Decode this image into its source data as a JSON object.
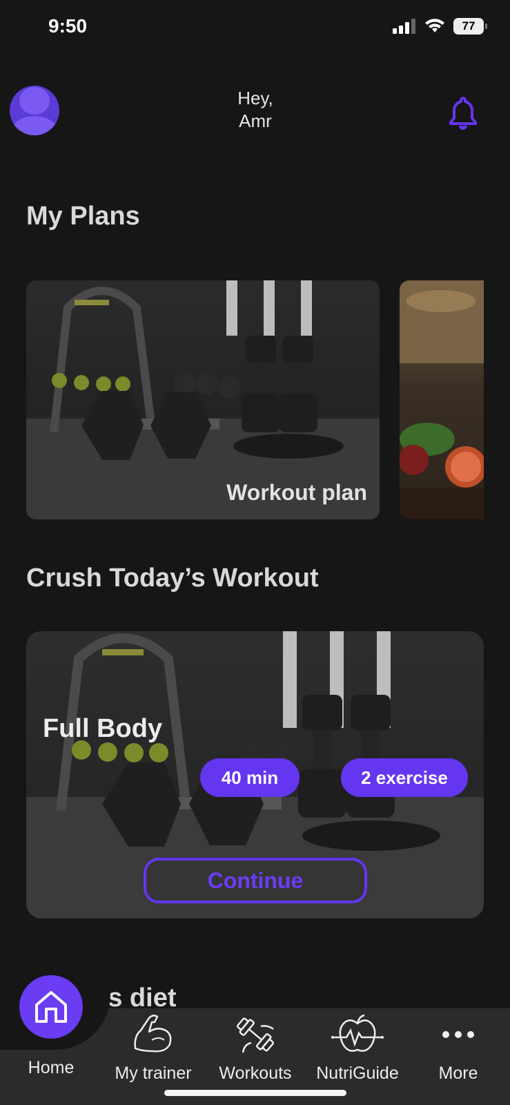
{
  "status_bar": {
    "time": "9:50",
    "battery": "77"
  },
  "header": {
    "greeting_line1": "Hey,",
    "greeting_line2": "Amr"
  },
  "my_plans": {
    "title": "My Plans",
    "cards": [
      {
        "label": "Workout plan"
      }
    ]
  },
  "today_workout": {
    "title": "Crush Today’s Workout",
    "name": "Full Body",
    "duration": "40 min",
    "exercises": "2 exercise",
    "continue_label": "Continue"
  },
  "diet": {
    "title": "Today’s diet"
  },
  "nav": {
    "items": [
      {
        "label": "Home",
        "icon": "home-icon",
        "active": true
      },
      {
        "label": "My trainer",
        "icon": "flexed-arm-icon"
      },
      {
        "label": "Workouts",
        "icon": "dumbbell-icon"
      },
      {
        "label": "NutriGuide",
        "icon": "apple-heartbeat-icon"
      },
      {
        "label": "More",
        "icon": "more-dots-icon"
      }
    ]
  },
  "colors": {
    "accent": "#6436f0",
    "background": "#161617",
    "nav_background": "#2b2b2c"
  }
}
